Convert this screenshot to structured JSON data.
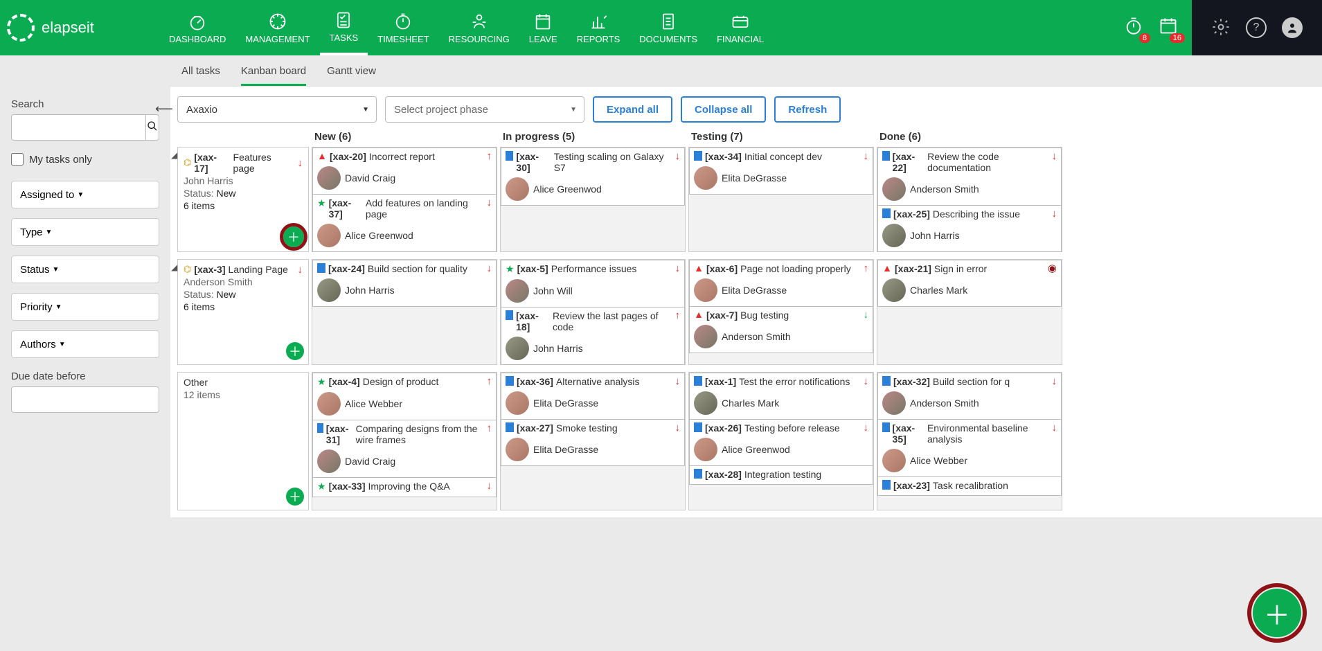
{
  "brand": "elapseit",
  "nav": {
    "items": [
      "DASHBOARD",
      "MANAGEMENT",
      "TASKS",
      "TIMESHEET",
      "RESOURCING",
      "LEAVE",
      "REPORTS",
      "DOCUMENTS",
      "FINANCIAL"
    ],
    "active": "TASKS",
    "badge_timer": "8",
    "badge_calendar": "16"
  },
  "subtabs": {
    "items": [
      "All tasks",
      "Kanban board",
      "Gantt view"
    ],
    "active": "Kanban board"
  },
  "sidebar": {
    "search_label": "Search",
    "search_value": "",
    "my_tasks_label": "My tasks only",
    "my_tasks_checked": false,
    "filters": [
      "Assigned to",
      "Type",
      "Status",
      "Priority",
      "Authors"
    ],
    "due_label": "Due date before",
    "due_value": ""
  },
  "toolbar": {
    "project": "Axaxio",
    "phase_placeholder": "Select project phase",
    "expand": "Expand all",
    "collapse": "Collapse all",
    "refresh": "Refresh"
  },
  "columns": [
    "New (6)",
    "In progress (5)",
    "Testing (7)",
    "Done (6)"
  ],
  "lanes": [
    {
      "epic": {
        "id": "[xax-17]",
        "title": "Features page",
        "owner": "John Harris",
        "status_label": "Status:",
        "status": "New",
        "count": "6 items",
        "arrow": "down-red",
        "add_hot": true
      },
      "cells": [
        [
          {
            "icon": "alert",
            "id": "[xax-20]",
            "title": "Incorrect report",
            "arrow": "up-red",
            "assignee": "David Craig",
            "av": "m"
          },
          {
            "icon": "star",
            "id": "[xax-37]",
            "title": "Add features on landing page",
            "arrow": "down-red",
            "assignee": "Alice Greenwod",
            "av": "f"
          }
        ],
        [
          {
            "icon": "flag",
            "id": "[xax-30]",
            "title": "Testing scaling on Galaxy S7",
            "arrow": "down-red",
            "assignee": "Alice Greenwod",
            "av": "f"
          }
        ],
        [
          {
            "icon": "flag",
            "id": "[xax-34]",
            "title": "Initial concept dev",
            "arrow": "down-red",
            "assignee": "Elita DeGrasse",
            "av": "f"
          }
        ],
        [
          {
            "icon": "flag",
            "id": "[xax-22]",
            "title": "Review the code documentation",
            "arrow": "down-red",
            "assignee": "Anderson Smith",
            "av": "m"
          },
          {
            "icon": "flag",
            "id": "[xax-25]",
            "title": "Describing the issue",
            "arrow": "down-red",
            "assignee": "John Harris",
            "av": "m2"
          }
        ]
      ]
    },
    {
      "epic": {
        "id": "[xax-3]",
        "title": "Landing Page",
        "owner": "Anderson Smith",
        "status_label": "Status:",
        "status": "New",
        "count": "6 items",
        "arrow": "down-red",
        "add_hot": false
      },
      "cells": [
        [
          {
            "icon": "flag",
            "id": "[xax-24]",
            "title": "Build section for quality",
            "arrow": "down-red",
            "assignee": "John Harris",
            "av": "m2"
          }
        ],
        [
          {
            "icon": "star",
            "id": "[xax-5]",
            "title": "Performance issues",
            "arrow": "down-red",
            "assignee": "John Will",
            "av": "m"
          },
          {
            "icon": "flag",
            "id": "[xax-18]",
            "title": "Review the last pages of code",
            "arrow": "up-red",
            "assignee": "John Harris",
            "av": "m2"
          }
        ],
        [
          {
            "icon": "alert",
            "id": "[xax-6]",
            "title": "Page not loading properly",
            "arrow": "up-red",
            "assignee": "Elita DeGrasse",
            "av": "f"
          },
          {
            "icon": "alert",
            "id": "[xax-7]",
            "title": "Bug testing",
            "arrow": "down-green",
            "assignee": "Anderson Smith",
            "av": "m"
          }
        ],
        [
          {
            "icon": "alert",
            "id": "[xax-21]",
            "title": "Sign in error",
            "arrow": "target-darkred",
            "assignee": "Charles Mark",
            "av": "m2"
          }
        ]
      ]
    },
    {
      "epic": {
        "title": "Other",
        "count": "12 items",
        "add_hot": false,
        "plain": true
      },
      "cells": [
        [
          {
            "icon": "star",
            "id": "[xax-4]",
            "title": "Design of product",
            "arrow": "up-red",
            "assignee": "Alice Webber",
            "av": "f"
          },
          {
            "icon": "flag",
            "id": "[xax-31]",
            "title": "Comparing designs from the wire frames",
            "arrow": "up-red",
            "assignee": "David Craig",
            "av": "m"
          },
          {
            "icon": "star",
            "id": "[xax-33]",
            "title": "Improving the Q&A",
            "arrow": "down-red",
            "assignee": "",
            "av": ""
          }
        ],
        [
          {
            "icon": "flag",
            "id": "[xax-36]",
            "title": "Alternative analysis",
            "arrow": "down-red",
            "assignee": "Elita DeGrasse",
            "av": "f"
          },
          {
            "icon": "flag",
            "id": "[xax-27]",
            "title": "Smoke testing",
            "arrow": "down-red",
            "assignee": "Elita DeGrasse",
            "av": "f"
          }
        ],
        [
          {
            "icon": "flag",
            "id": "[xax-1]",
            "title": "Test the error notifications",
            "arrow": "down-red",
            "assignee": "Charles Mark",
            "av": "m2"
          },
          {
            "icon": "flag",
            "id": "[xax-26]",
            "title": "Testing before release",
            "arrow": "down-red",
            "assignee": "Alice Greenwod",
            "av": "f"
          },
          {
            "icon": "flag",
            "id": "[xax-28]",
            "title": "Integration testing",
            "arrow": "",
            "assignee": "",
            "av": ""
          }
        ],
        [
          {
            "icon": "flag",
            "id": "[xax-32]",
            "title": "Build section for q",
            "arrow": "down-red",
            "assignee": "Anderson Smith",
            "av": "m"
          },
          {
            "icon": "flag",
            "id": "[xax-35]",
            "title": "Environmental baseline analysis",
            "arrow": "down-red",
            "assignee": "Alice Webber",
            "av": "f"
          },
          {
            "icon": "flag",
            "id": "[xax-23]",
            "title": "Task recalibration",
            "arrow": "",
            "assignee": "",
            "av": ""
          }
        ]
      ]
    }
  ]
}
